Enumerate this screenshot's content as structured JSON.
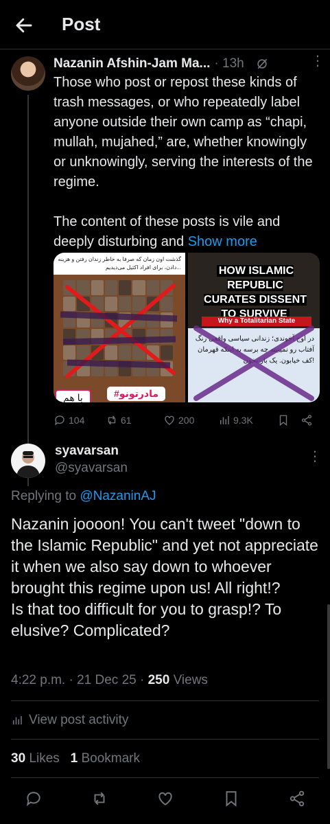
{
  "header": {
    "title": "Post"
  },
  "parent_post": {
    "author": "Nazanin Afshin-Jam Ma...",
    "time": "· 13h",
    "paragraphs": [
      "Those who post or repost these kinds of trash messages, or who repeatedly label anyone outside their own camp as “chapi, mullah, mujahed,” are, whether knowingly or unknowingly, serving the interests of the regime.",
      "The content of these posts is vile and deeply disturbing and"
    ],
    "show_more": "Show more",
    "media1": {
      "top_text": "گذشت اون زمان که صرفا به خاطر زندان رفتن و هزینه دادن، برای افراد اکثیل می‌دیدیم...",
      "button_a": "#مادرتونو",
      "button_b": "با هم"
    },
    "media2": {
      "headline": "HOW ISLAMIC REPUBLIC CURATES DISSENT TO SURVIVE",
      "bar": "Why a Totalitarian State",
      "bottom_text": "در اوج آخوندی؛ زندانی سیاسی واقعی رنگ آفتاب رو نمیبینه چه برسه به اینکه قهرمان کف خیابون. یک بار بخون!"
    },
    "counts": {
      "replies": "104",
      "reposts": "61",
      "likes": "200",
      "views": "9.3K"
    }
  },
  "reply_post": {
    "name": "syavarsan",
    "handle": "@syavarsan",
    "replying_prefix": "Replying to ",
    "replying_handle": "@NazaninAJ",
    "text": "Nazanin joooon! You can't tweet \"down to the Islamic Republic\" and yet not appreciate it when we also say down to whoever brought this regime upon us! All right!?\nIs that too difficult for you to grasp!? To elusive? Complicated?",
    "time": "4:22 p.m. · 21 Dec 25 · ",
    "views_count": "250",
    "views_label": " Views",
    "activity": "View post activity",
    "likes_count": "30",
    "likes_label": " Likes",
    "bookmarks_count": "1",
    "bookmarks_label": " Bookmark"
  },
  "colors": {
    "background": "#000000",
    "text": "#e7e9ea",
    "muted": "#71767b",
    "accent": "#1d9bf0",
    "divider": "#2f3336"
  }
}
